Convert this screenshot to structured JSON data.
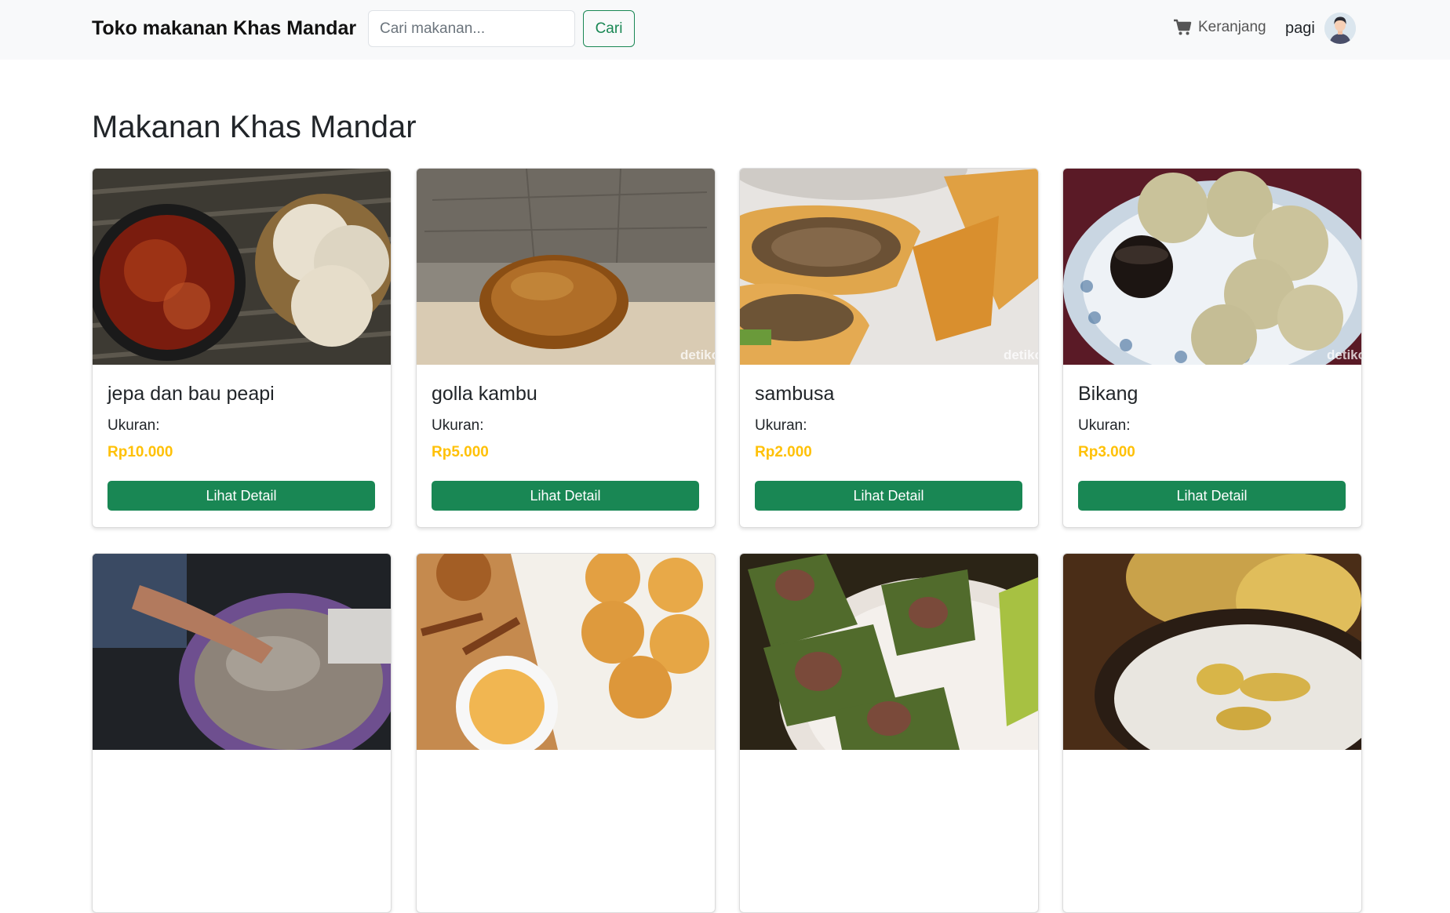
{
  "navbar": {
    "brand": "Toko makanan Khas Mandar",
    "search_placeholder": "Cari makanan...",
    "search_button": "Cari",
    "cart_label": "Keranjang",
    "cart_icon": "cart-icon",
    "username": "pagi",
    "avatar_icon": "user-avatar"
  },
  "main": {
    "title": "Makanan Khas Mandar",
    "products": [
      {
        "name": "jepa dan bau peapi",
        "size_label": "Ukuran:",
        "price": "Rp10.000",
        "button": "Lihat Detail"
      },
      {
        "name": "golla kambu",
        "size_label": "Ukuran:",
        "price": "Rp5.000",
        "button": "Lihat Detail",
        "watermark": "detiko"
      },
      {
        "name": "sambusa",
        "size_label": "Ukuran:",
        "price": "Rp2.000",
        "button": "Lihat Detail",
        "watermark": "detiko"
      },
      {
        "name": "Bikang",
        "size_label": "Ukuran:",
        "price": "Rp3.000",
        "button": "Lihat Detail",
        "watermark": "detiko"
      }
    ]
  },
  "colors": {
    "accent_green": "#198754",
    "price_yellow": "#ffc107",
    "navbar_bg": "#f8f9fa"
  }
}
